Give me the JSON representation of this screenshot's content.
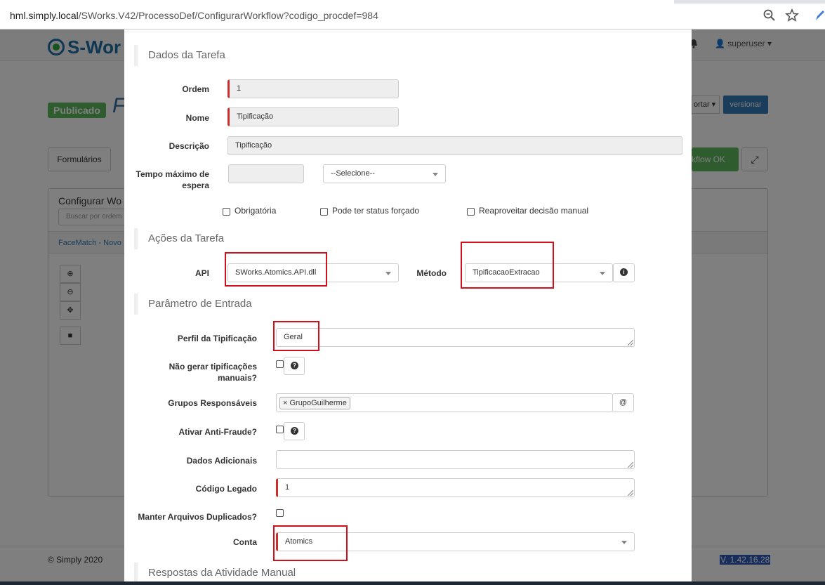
{
  "browser": {
    "url_host": "hml.simply.local",
    "url_path": "/SWorks.V42/ProcessoDef/ConfigurarWorkflow?codigo_procdef=984"
  },
  "background": {
    "logo_text": "S-Wor",
    "user_label": "superuser",
    "status_badge": "Publicado",
    "title_fragment": "F",
    "export_label": "ortar",
    "version_button": "versionar",
    "tab_forms": "Formulários",
    "workflow_ok": "kflow OK",
    "panel_title": "Configurar Wo",
    "search_placeholder": "Buscar por ordem",
    "process_link": "FaceMatch - Novo",
    "copyright": "© Simply 2020",
    "version": "V. 1.42.16.28"
  },
  "modal": {
    "sections": {
      "dados": "Dados da Tarefa",
      "acoes": "Ações da Tarefa",
      "param": "Parâmetro de Entrada",
      "respostas": "Respostas da Atividade Manual"
    },
    "dados": {
      "ordem_label": "Ordem",
      "ordem_value": "1",
      "nome_label": "Nome",
      "nome_value": "Tipificação",
      "descricao_label": "Descrição",
      "descricao_value": "Tipificação",
      "tempo_label_1": "Tempo máximo de",
      "tempo_label_2": "espera",
      "tempo_value": "",
      "tempo_select": "--Selecione--",
      "obrigatoria": "Obrigatória",
      "status_forcado": "Pode ter status forçado",
      "reaproveitar": "Reaproveitar decisão manual"
    },
    "acoes": {
      "api_label": "API",
      "api_value": "SWorks.Atomics.API.dll",
      "metodo_label": "Método",
      "metodo_value": "TipificacaoExtracao"
    },
    "param": {
      "perfil_label": "Perfil da Tipificação",
      "perfil_value": "Geral",
      "nao_gerar_label_1": "Não gerar tipificações",
      "nao_gerar_label_2": "manuais?",
      "grupos_label": "Grupos Responsáveis",
      "grupos_tag": "GrupoGuilherme",
      "grupos_tag_remove": "×",
      "at_symbol": "@",
      "antifraude_label": "Ativar Anti-Fraude?",
      "dados_adicionais_label": "Dados Adicionais",
      "dados_adicionais_value": "",
      "codigo_legado_label": "Código Legado",
      "codigo_legado_value": "1",
      "manter_label": "Manter Arquivos Duplicados?",
      "conta_label": "Conta",
      "conta_value": "Atomics"
    }
  },
  "colors": {
    "required_bar": "#c9302c",
    "highlight_box": "#d0101b",
    "primary": "#337ab7",
    "success": "#5cb85c"
  }
}
